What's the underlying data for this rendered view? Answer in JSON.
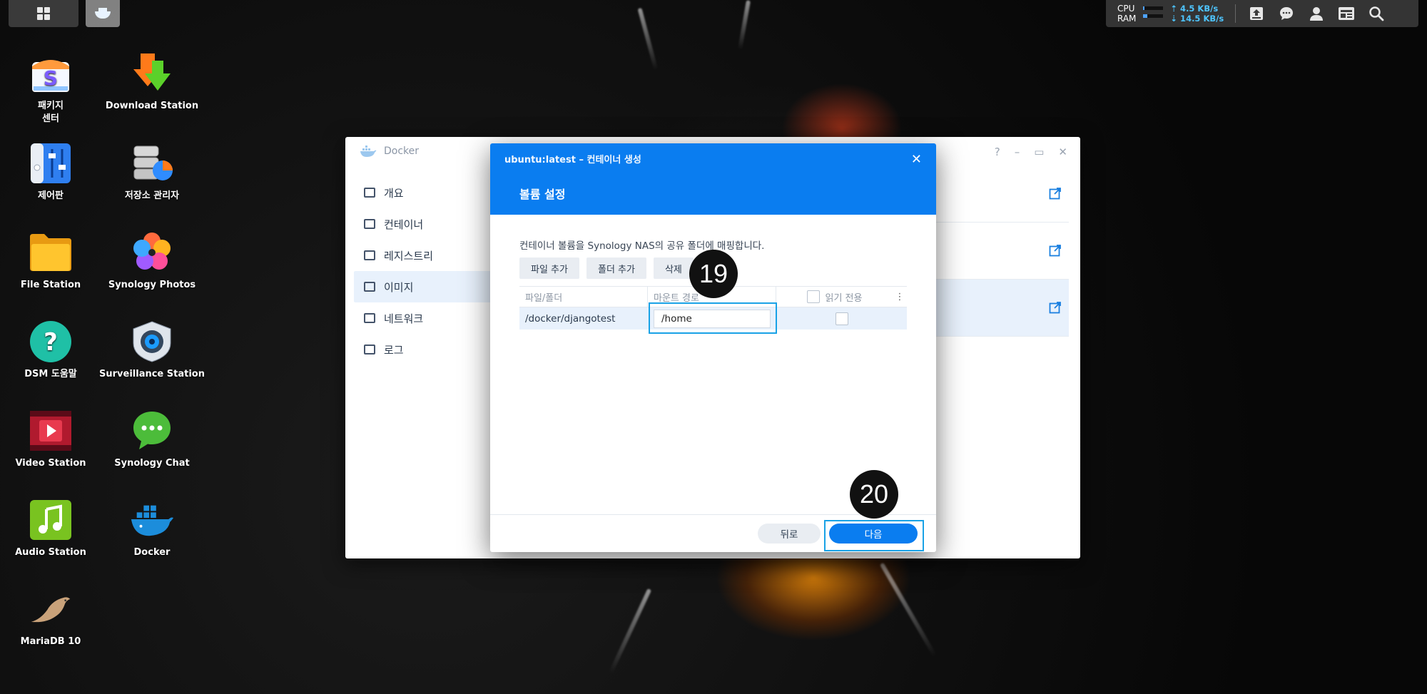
{
  "taskbar": {
    "cpu_label": "CPU",
    "ram_label": "RAM",
    "cpu_level": 0.05,
    "ram_level": 0.2,
    "upload_speed": "⇡ 4.5 KB/s",
    "download_speed": "⇣ 14.5 KB/s"
  },
  "desktop": {
    "icons": [
      {
        "label": "패키지\n센터",
        "icon": "package-center-icon"
      },
      {
        "label": "Download Station",
        "icon": "download-station-icon"
      },
      {
        "label": "제어판",
        "icon": "control-panel-icon"
      },
      {
        "label": "저장소 관리자",
        "icon": "storage-manager-icon"
      },
      {
        "label": "File Station",
        "icon": "file-station-icon"
      },
      {
        "label": "Synology Photos",
        "icon": "synology-photos-icon"
      },
      {
        "label": "DSM 도움말",
        "icon": "dsm-help-icon"
      },
      {
        "label": "Surveillance Station",
        "icon": "surveillance-station-icon"
      },
      {
        "label": "Video Station",
        "icon": "video-station-icon"
      },
      {
        "label": "Synology Chat",
        "icon": "synology-chat-icon"
      },
      {
        "label": "Audio Station",
        "icon": "audio-station-icon"
      },
      {
        "label": "Docker",
        "icon": "docker-icon"
      },
      {
        "label": "MariaDB 10",
        "icon": "mariadb-icon"
      }
    ]
  },
  "docker_window": {
    "title": "Docker",
    "controls": [
      "?",
      "–",
      "▭",
      "✕"
    ],
    "nav": [
      {
        "label": "개요",
        "active": false
      },
      {
        "label": "컨테이너",
        "active": false
      },
      {
        "label": "레지스트리",
        "active": false
      },
      {
        "label": "이미지",
        "active": true
      },
      {
        "label": "네트워크",
        "active": false
      },
      {
        "label": "로그",
        "active": false
      }
    ]
  },
  "modal": {
    "title": "ubuntu:latest – 컨테이너 생성",
    "close": "✕",
    "step_title": "볼륨 설정",
    "description": "컨테이너 볼륨을 Synology NAS의 공유 폴더에 매핑합니다.",
    "toolbar": {
      "add_file": "파일 추가",
      "add_folder": "폴더 추가",
      "delete": "삭제"
    },
    "table": {
      "col_file_folder": "파일/폴더",
      "col_mount_path": "마운트 경로",
      "col_read_only": "읽기 전용",
      "col_menu": "⋮",
      "rows": [
        {
          "file_folder": "/docker/djangotest",
          "mount_path": "/home",
          "read_only": false
        }
      ]
    },
    "footer": {
      "back": "뒤로",
      "next": "다음"
    }
  },
  "annotations": {
    "step19": "19",
    "step20": "20"
  },
  "colors": {
    "accent": "#0a7df0",
    "highlight": "#19a2e6",
    "selected_row": "#e8f1fc"
  }
}
